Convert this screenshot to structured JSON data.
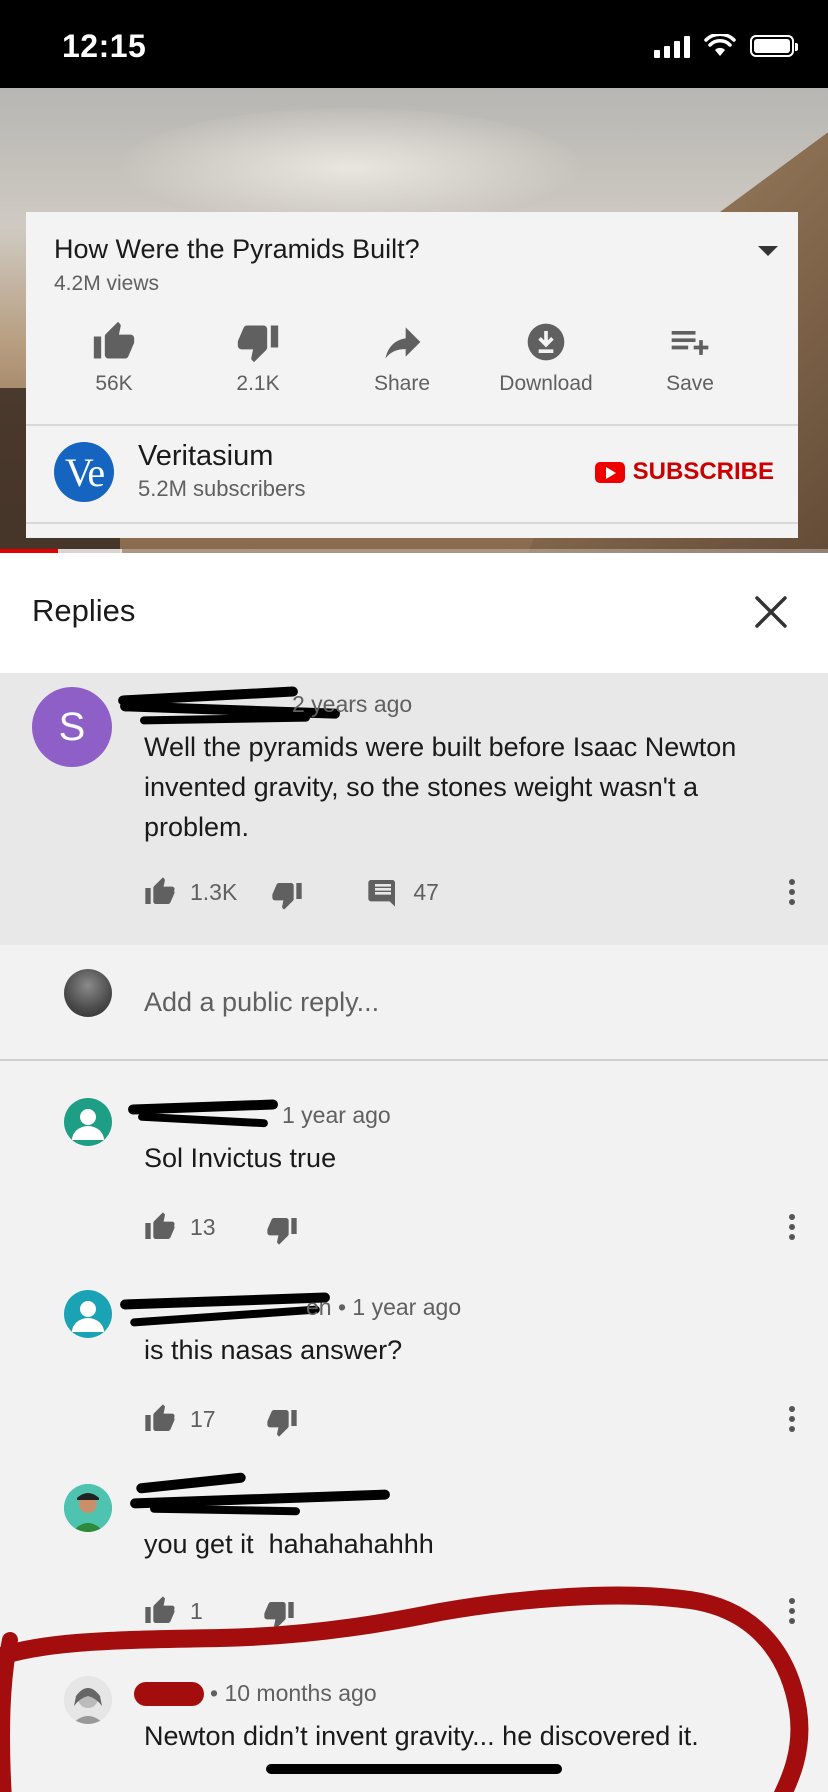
{
  "status_bar": {
    "time": "12:15"
  },
  "video": {
    "title": "How Were the Pyramids Built?",
    "views": "4.2M views",
    "actions": [
      {
        "label": "56K",
        "icon": "thumbs-up-icon"
      },
      {
        "label": "2.1K",
        "icon": "thumbs-down-icon"
      },
      {
        "label": "Share",
        "icon": "share-icon"
      },
      {
        "label": "Download",
        "icon": "download-icon"
      },
      {
        "label": "Save",
        "icon": "add-to-playlist-icon"
      }
    ],
    "progress_fraction": 0.07
  },
  "channel": {
    "avatar_text": "Ve",
    "name": "Veritasium",
    "subscribers": "5.2M subscribers",
    "subscribe_label": "SUBSCRIBE",
    "subscribe_color": "#cc0000"
  },
  "replies_panel": {
    "title": "Replies"
  },
  "parent_comment": {
    "avatar_letter": "S",
    "avatar_color": "#8e5fc7",
    "time": "2 years ago",
    "text": "Well the pyramids were built before Isaac Newton invented gravity, so the stones weight wasn't a problem.",
    "likes": "1.3K",
    "reply_count": "47"
  },
  "reply_input": {
    "placeholder": "Add a public reply..."
  },
  "replies": [
    {
      "meta": "1 year ago",
      "text": "Sol Invictus true",
      "likes": "13"
    },
    {
      "meta": "en • 1 year ago",
      "text": "is this nasas answer?",
      "likes": "17"
    },
    {
      "meta": "1 year ago",
      "text": "you get it  hahahahahhh",
      "likes": "1"
    },
    {
      "meta": "• 10 months ago",
      "text": "Newton didn’t invent gravity... he discovered it.",
      "likes": ""
    }
  ],
  "annotation_color": "#a30d0d"
}
